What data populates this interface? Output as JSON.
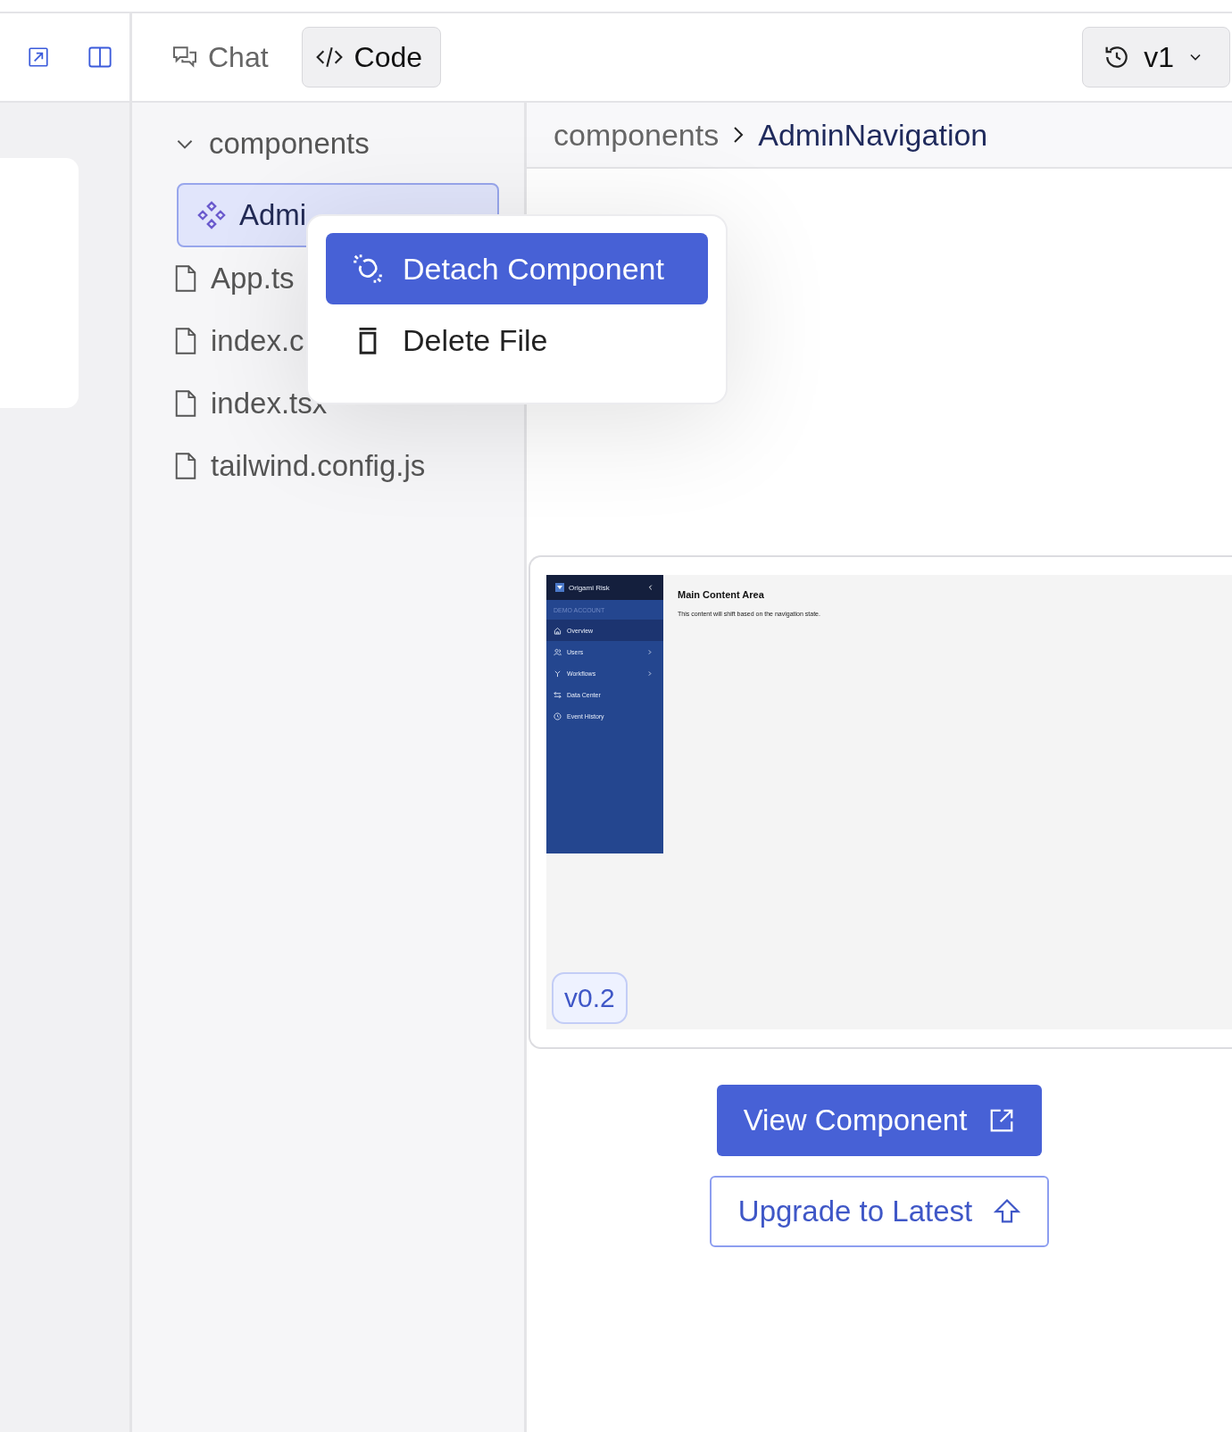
{
  "toolbar": {
    "tabs": [
      {
        "label": "Chat",
        "kind": "chat",
        "selected": false
      },
      {
        "label": "Code",
        "kind": "code",
        "selected": true
      }
    ],
    "version_menu": {
      "label": "v1"
    }
  },
  "file_tree": {
    "name": "components",
    "expanded": true,
    "children": [
      {
        "name": "Admi",
        "kind": "component",
        "selected": true
      },
      {
        "name": "App.ts",
        "kind": "file",
        "selected": false
      },
      {
        "name": "index.c",
        "kind": "file",
        "selected": false
      },
      {
        "name": "index.tsx",
        "kind": "file",
        "selected": false
      },
      {
        "name": "tailwind.config.js",
        "kind": "file",
        "selected": false
      }
    ]
  },
  "context_menu": {
    "items": [
      {
        "label": "Detach Component",
        "kind": "detach",
        "selected": true
      },
      {
        "label": "Delete File",
        "kind": "delete",
        "selected": false
      }
    ]
  },
  "breadcrumb": [
    "components",
    "AdminNavigation"
  ],
  "preview": {
    "app_name": "Origami Risk",
    "account": "DEMO ACCOUNT",
    "nav": [
      {
        "label": "Overview",
        "kind": "home",
        "selected": true,
        "submenu": false
      },
      {
        "label": "Users",
        "kind": "users",
        "selected": false,
        "submenu": true
      },
      {
        "label": "Workflows",
        "kind": "workflow",
        "selected": false,
        "submenu": true
      },
      {
        "label": "Data Center",
        "kind": "transfer",
        "selected": false,
        "submenu": false
      },
      {
        "label": "Event History",
        "kind": "clock",
        "selected": false,
        "submenu": false
      }
    ],
    "heading": "Main Content Area",
    "text": "This content will shift based on the navigation state.",
    "version": "v0.2"
  },
  "buttons": [
    {
      "label": "View Component",
      "kind": "primary"
    },
    {
      "label": "Upgrade to Latest",
      "kind": "outline"
    }
  ]
}
